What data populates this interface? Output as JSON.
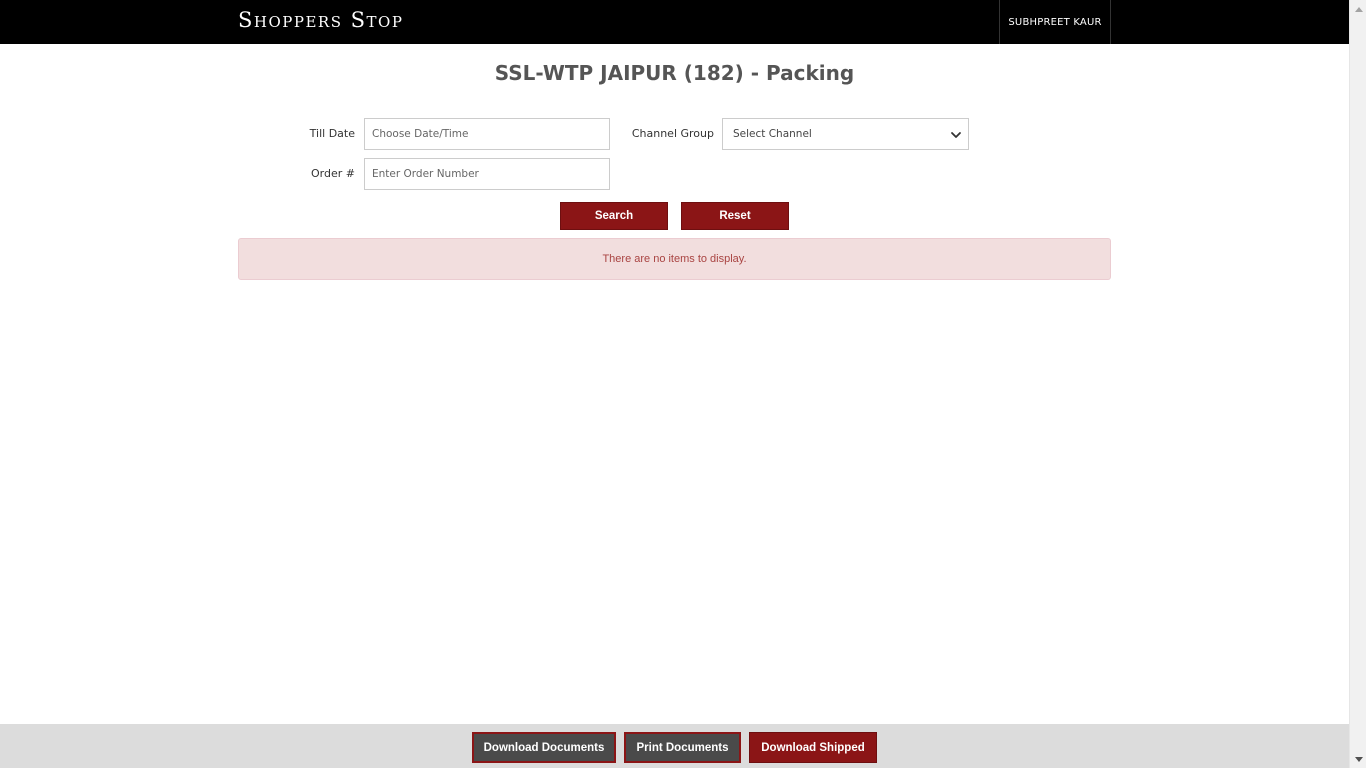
{
  "header": {
    "brand": "Shoppers Stop",
    "user_name": "SUBHPREET KAUR"
  },
  "page": {
    "title": "SSL-WTP JAIPUR (182) - Packing"
  },
  "filters": {
    "till_date_label": "Till Date",
    "till_date_placeholder": "Choose Date/Time",
    "order_label": "Order #",
    "order_placeholder": "Enter Order Number",
    "channel_group_label": "Channel Group",
    "channel_group_selected": "Select Channel"
  },
  "actions": {
    "search_label": "Search",
    "reset_label": "Reset"
  },
  "alert": {
    "message": "There are no items to display."
  },
  "footer": {
    "download_documents_label": "Download Documents",
    "print_documents_label": "Print Documents",
    "download_shipped_label": "Download Shipped"
  },
  "colors": {
    "brand_red": "#8b1516",
    "header_bg": "#000000",
    "footer_bg": "#dcdcdc",
    "alert_bg": "#f2dede",
    "alert_text": "#a94442"
  },
  "icons": {
    "select_arrow": "chevron-down-icon",
    "scroll_up": "caret-up-icon",
    "scroll_down": "caret-down-icon"
  }
}
